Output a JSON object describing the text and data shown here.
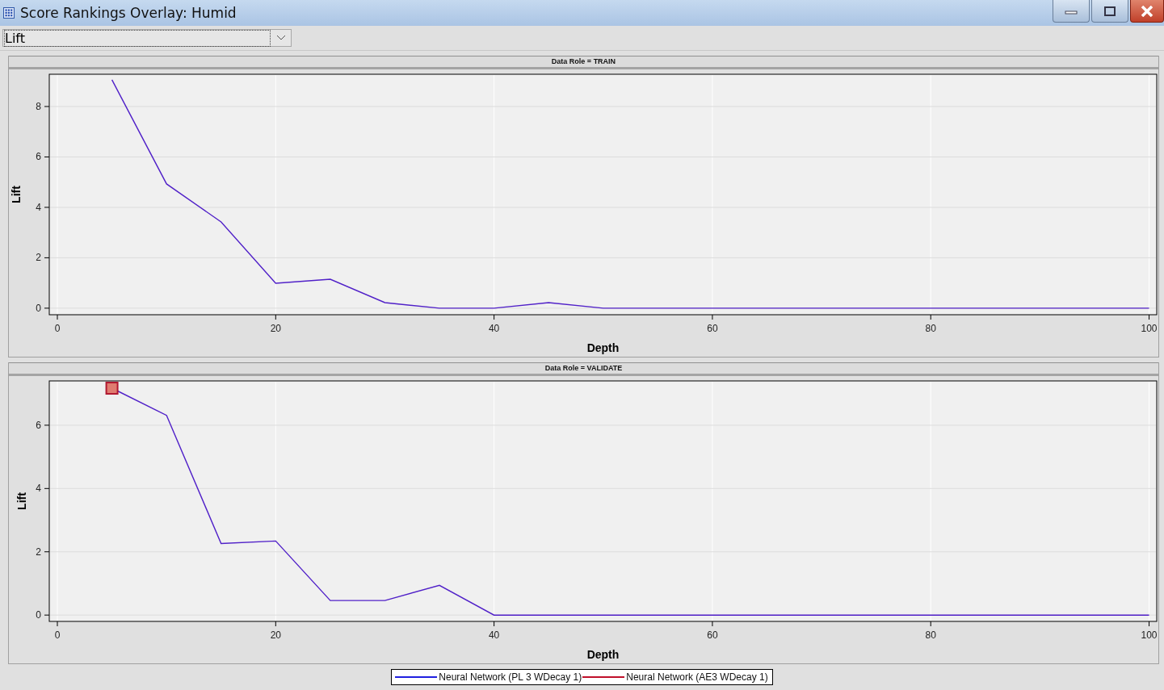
{
  "window": {
    "title": "Score Rankings Overlay: Humid"
  },
  "toolbar": {
    "dropdown": {
      "value": "Lift"
    }
  },
  "panels": [
    {
      "header": "Data Role = TRAIN",
      "chart_data": {
        "type": "line",
        "xlabel": "Depth",
        "ylabel": "Lift",
        "grid": true,
        "x": [
          5,
          10,
          15,
          20,
          25,
          30,
          35,
          40,
          45,
          50,
          55,
          60,
          65,
          70,
          75,
          80,
          85,
          90,
          95,
          100
        ],
        "xlim": [
          -0.74,
          100.7
        ],
        "ylim": [
          -0.26,
          9.28
        ],
        "xticks": [
          0,
          20,
          40,
          60,
          80,
          100
        ],
        "yticks": [
          0,
          2,
          4,
          6,
          8
        ],
        "values": [
          9.06,
          4.93,
          3.42,
          0.99,
          1.15,
          0.22,
          0,
          0,
          0.22,
          0,
          0,
          0,
          0,
          0,
          0,
          0,
          0,
          0,
          0,
          0
        ]
      }
    },
    {
      "header": "Data Role = VALIDATE",
      "chart_data": {
        "type": "line",
        "xlabel": "Depth",
        "ylabel": "Lift",
        "grid": true,
        "x": [
          5,
          10,
          15,
          20,
          25,
          30,
          35,
          40,
          45,
          50,
          55,
          60,
          65,
          70,
          75,
          80,
          85,
          90,
          95,
          100
        ],
        "xlim": [
          -0.74,
          100.7
        ],
        "ylim": [
          -0.2,
          7.4
        ],
        "xticks": [
          0,
          20,
          40,
          60,
          80,
          100
        ],
        "yticks": [
          0,
          2,
          4,
          6
        ],
        "values": [
          7.17,
          6.31,
          2.26,
          2.34,
          0.46,
          0.46,
          0.94,
          0,
          0,
          0,
          0,
          0,
          0,
          0,
          0,
          0,
          0,
          0,
          0,
          0
        ]
      },
      "first_point_selected": true
    }
  ],
  "legend": [
    {
      "label": "Neural Network (PL 3 WDecay 1)",
      "color": "#2020e0"
    },
    {
      "label": "Neural Network (AE3 WDecay 1)",
      "color": "#c0102a"
    }
  ]
}
